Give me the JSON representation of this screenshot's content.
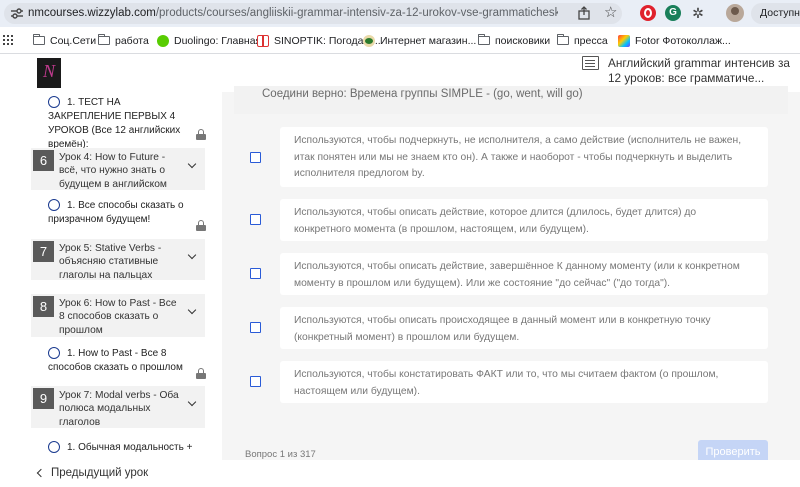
{
  "browser": {
    "url_host": "nmcourses.wizzylab.com",
    "url_path": "/products/courses/angliiskii-grammar-intensiv-za-12-urokov-vse-grammaticheskie-vremena-...",
    "profile_label": "Доступно",
    "extension_g_letter": "G"
  },
  "bookmarks": [
    {
      "label": "Соц.Сети",
      "icon": "folder-icon"
    },
    {
      "label": "работа",
      "icon": "folder-icon"
    },
    {
      "label": "Duolingo: Главная",
      "icon": "duolingo-icon"
    },
    {
      "label": "SINOPTIK: Погода в...",
      "icon": "sinoptik-icon"
    },
    {
      "label": "Интернет магазин...",
      "icon": "shop-icon"
    },
    {
      "label": "поисковики",
      "icon": "folder-icon"
    },
    {
      "label": "пресса",
      "icon": "folder-icon"
    },
    {
      "label": "Fotor Фотоколлаж...",
      "icon": "fotor-icon"
    }
  ],
  "header": {
    "course_title": "Английский grammar интенсив за 12 уроков: все грамматиче..."
  },
  "sidebar": {
    "top_lesson": "1. ТЕСТ НА ЗАКРЕПЛЕНИЕ ПЕРВЫХ 4 УРОКОВ (Все 12 английских времён):",
    "modules": [
      {
        "number": "6",
        "title": "Урок 4: How to Future - всё, что нужно знать о будущем в английском"
      },
      {
        "number": "7",
        "title": "Урок 5: Stative Verbs - объясняю стативные глаголы на пальцах"
      },
      {
        "number": "8",
        "title": "Урок 6: How to Past - Все 8 способов сказать о прошлом"
      },
      {
        "number": "9",
        "title": "Урок 7: Modal verbs - Оба полюса модальных глаголов"
      }
    ],
    "lessons": [
      "1. Все способы сказать о призрачном будущем!",
      "1. How to Past - Все 8 способов сказать о прошлом",
      "1. Обычная модальность +"
    ]
  },
  "main": {
    "question_title": "Соедини верно: Времена группы SIMPLE - (go, went, will go)",
    "answers": [
      "Используются, чтобы подчеркнуть, не исполнителя, а само действие (исполнитель не важен, итак понятен или мы не знаем кто он). А также и наоборот - чтобы подчеркнуть и выделить исполнителя предлогом by.",
      "Используются, чтобы описать действие, которое длится (длилось, будет длится) до конкретного момента (в прошлом, настоящем, или будущем).",
      "Используются, чтобы описать действие, завершённое К данному моменту (или к конкретном моменту в прошлом или будущем). Или же состояние \"до сейчас\" (\"до тогда\").",
      "Используются, чтобы описать происходящее в данный момент или в конкретную точку (конкретный момент) в прошлом или будущем.",
      "Используются, чтобы констатировать ФАКТ или то, что мы считаем фактом (о прошлом, настоящем или будущем)."
    ],
    "counter": "Вопрос 1 из 317",
    "check_button": "Проверить"
  },
  "footer": {
    "prev_lesson": "Предыдущий урок"
  },
  "colors": {
    "accent": "#2a5bd7",
    "button_disabled": "#c5d5f6",
    "module_badge": "#5a5a5a"
  }
}
